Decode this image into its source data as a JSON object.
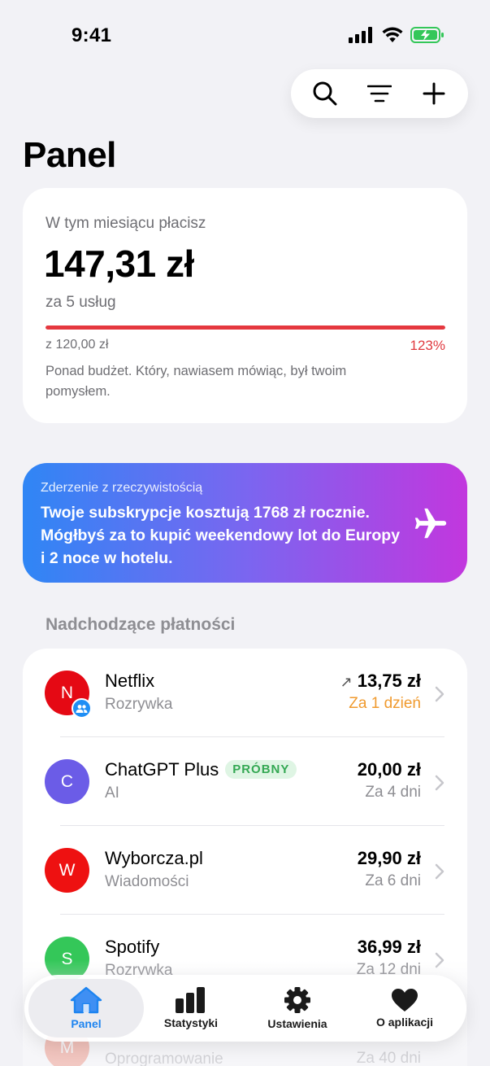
{
  "status_bar": {
    "time": "9:41"
  },
  "header": {
    "title": "Panel"
  },
  "budget": {
    "label": "W tym miesiącu płacisz",
    "amount": "147,31 zł",
    "services": "za 5 usług",
    "limit": "z 120,00 zł",
    "percent_text": "123%",
    "progress": 1.0,
    "note": "Ponad budżet. Który, nawiasem mówiąc, był twoim pomysłem."
  },
  "reality_check": {
    "label": "Zderzenie z rzeczywistością",
    "text": "Twoje subskrypcje kosztują 1768 zł rocznie. Mógłbyś za to kupić weekendowy lot do Europy i 2 noce w hotelu.",
    "icon": "airplane-icon"
  },
  "upcoming": {
    "title": "Nadchodzące płatności",
    "items": [
      {
        "initial": "N",
        "name": "Netflix",
        "category": "Rozrywka",
        "price": "13,75 zł",
        "due": "Za 1 dzień",
        "color": "#e50914",
        "badge": "",
        "trend": "↗"
      },
      {
        "initial": "C",
        "name": "ChatGPT Plus",
        "category": "AI",
        "price": "20,00 zł",
        "due": "Za 4 dni",
        "color": "#6b5ce7",
        "badge": "PRÓBNY",
        "trend": ""
      },
      {
        "initial": "W",
        "name": "Wyborcza.pl",
        "category": "Wiadomości",
        "price": "29,90 zł",
        "due": "Za 6 dni",
        "color": "#ee1111",
        "badge": "",
        "trend": ""
      },
      {
        "initial": "S",
        "name": "Spotify",
        "category": "Rozrywka",
        "price": "36,99 zł",
        "due": "Za 12 dni",
        "color": "#34c759",
        "badge": "",
        "trend": ""
      },
      {
        "initial": "M",
        "name": "",
        "category": "Oprogramowanie",
        "price": "",
        "due": "Za 40 dni",
        "color": "#f0664a",
        "badge": "",
        "trend": ""
      }
    ]
  },
  "tabs": [
    {
      "label": "Panel",
      "icon": "house-icon",
      "active": true
    },
    {
      "label": "Statystyki",
      "icon": "bar-chart-icon",
      "active": false
    },
    {
      "label": "Ustawienia",
      "icon": "gear-icon",
      "active": false
    },
    {
      "label": "O aplikacji",
      "icon": "heart-icon",
      "active": false
    }
  ],
  "colors": {
    "accent": "#1d84f0",
    "danger": "#e5383f",
    "warning": "#f09a2e"
  }
}
